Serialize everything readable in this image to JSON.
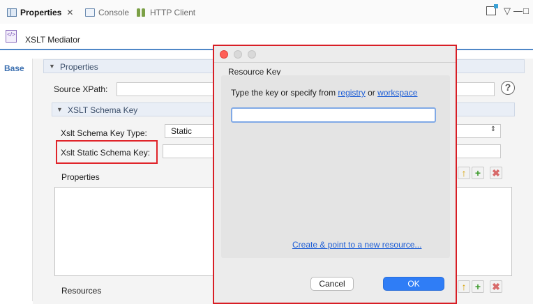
{
  "tabs": [
    {
      "label": "Properties",
      "icon": "properties-icon",
      "active": true
    },
    {
      "label": "Console",
      "icon": "console-icon",
      "active": false
    },
    {
      "label": "HTTP Client",
      "icon": "http-client-icon",
      "active": false
    }
  ],
  "tab_close_glyph": "✕",
  "window_controls": {
    "view_menu": "▽",
    "minimize": "—",
    "maximize": "□"
  },
  "editor": {
    "icon_text": "</>",
    "title": "XSLT Mediator"
  },
  "side_tab": {
    "label": "Base"
  },
  "properties_section": {
    "title": "Properties",
    "source_xpath_label": "Source XPath:",
    "source_xpath_value": "",
    "help_glyph": "?"
  },
  "schema_section": {
    "title": "XSLT Schema Key",
    "key_type_label": "Xslt Schema Key Type:",
    "key_type_value": "Static",
    "static_key_label": "Xslt Static Schema Key:",
    "static_key_value": ""
  },
  "properties_table": {
    "label": "Properties"
  },
  "resources_table": {
    "label": "Resources"
  },
  "action_icons": {
    "up": "↑",
    "add": "+",
    "delete": "✖"
  },
  "dialog": {
    "title": "Resource Key",
    "instruction_prefix": "Type the key or specify from ",
    "registry_link": "registry",
    "instruction_or": " or ",
    "workspace_link": "workspace",
    "key_value": "",
    "create_link": "Create & point to a new resource...",
    "cancel_label": "Cancel",
    "ok_label": "OK"
  },
  "colors": {
    "accent_blue": "#2f7df6",
    "highlight_red": "#e0242a",
    "close_red": "#ff5f57"
  }
}
